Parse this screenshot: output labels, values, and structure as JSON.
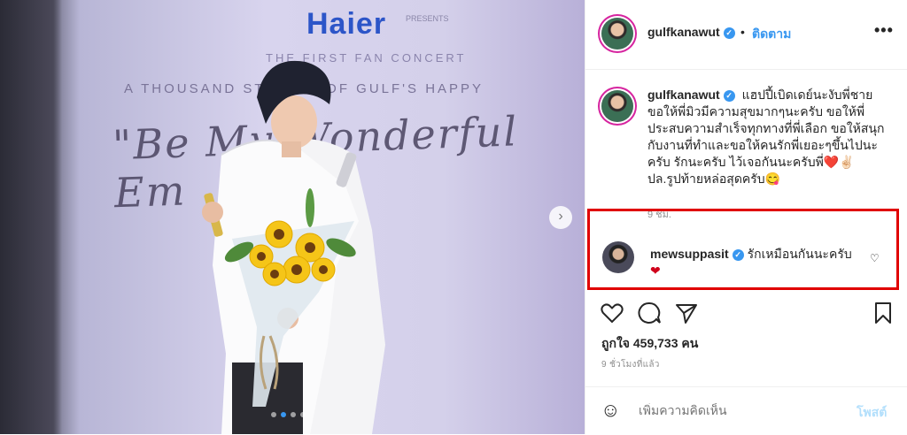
{
  "photo": {
    "sponsor": "Haier",
    "presents": "PRESENTS",
    "concert_line": "THE FIRST FAN CONCERT",
    "stories_line": "A THOUSAND STORIES OF GULF'S HAPPY",
    "script_line": "\"Be My Wonderful Em",
    "next_icon": "chevron-right-icon"
  },
  "header": {
    "username": "gulfkanawut",
    "separator": "•",
    "follow_label": "ติดตาม",
    "more_label": "•••"
  },
  "caption": {
    "username": "gulfkanawut",
    "text": "แฮปปี้เบิดเดย์นะงับพี่ชาย ขอให้พี่มิวมีความสุขมากๆนะครับ ขอให้พี่ประสบความสำเร็จทุกทางที่พี่เลือก ขอให้สนุกกับงานที่ทำและขอให้คนรักพี่เยอะๆขึ้นไปนะครับ รักนะครับ ไว้เจอกันนะครับพี่❤️✌🏻 ปล.รูปท้ายหล่อสุดครับ😋",
    "time": "9 ชม."
  },
  "comment": {
    "username": "mewsuppasit",
    "text": "รักเหมือนกันนะครับ",
    "heart": "❤"
  },
  "actions": {
    "like_icon": "heart-outline-icon",
    "comment_icon": "comment-bubble-icon",
    "share_icon": "paper-plane-icon",
    "save_icon": "bookmark-icon"
  },
  "likes": {
    "label": "ถูกใจ 459,733 คน"
  },
  "posted": "9 ชั่วโมงที่แล้ว",
  "comment_bar": {
    "placeholder": "เพิ่มความคิดเห็น",
    "post_label": "โพสต์"
  },
  "colors": {
    "accent": "#3897f0",
    "highlight_box": "#e00000",
    "heart": "#d0021b"
  }
}
